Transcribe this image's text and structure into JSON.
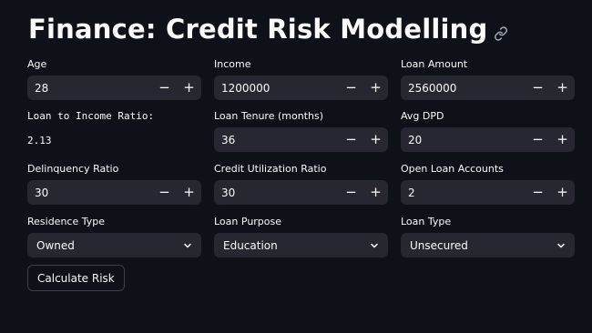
{
  "page": {
    "title": "Finance: Credit Risk Modelling"
  },
  "fields": {
    "age": {
      "label": "Age",
      "value": "28"
    },
    "income": {
      "label": "Income",
      "value": "1200000"
    },
    "loan_amount": {
      "label": "Loan Amount",
      "value": "2560000"
    },
    "loan_tenure": {
      "label": "Loan Tenure (months)",
      "value": "36"
    },
    "avg_dpd": {
      "label": "Avg DPD",
      "value": "20"
    },
    "delinquency_ratio": {
      "label": "Delinquency Ratio",
      "value": "30"
    },
    "credit_utilization_ratio": {
      "label": "Credit Utilization Ratio",
      "value": "30"
    },
    "open_loan_accounts": {
      "label": "Open Loan Accounts",
      "value": "2"
    },
    "residence_type": {
      "label": "Residence Type",
      "value": "Owned"
    },
    "loan_purpose": {
      "label": "Loan Purpose",
      "value": "Education"
    },
    "loan_type": {
      "label": "Loan Type",
      "value": "Unsecured"
    }
  },
  "ratio": {
    "label": "Loan to Income Ratio:",
    "value": "2.13"
  },
  "stepper": {
    "minus": "−",
    "plus": "+"
  },
  "actions": {
    "calculate_label": "Calculate Risk"
  },
  "colors": {
    "background": "#0e1117",
    "input_bg": "#262730",
    "text": "#fafafa",
    "button_border": "#3d3f4a"
  }
}
